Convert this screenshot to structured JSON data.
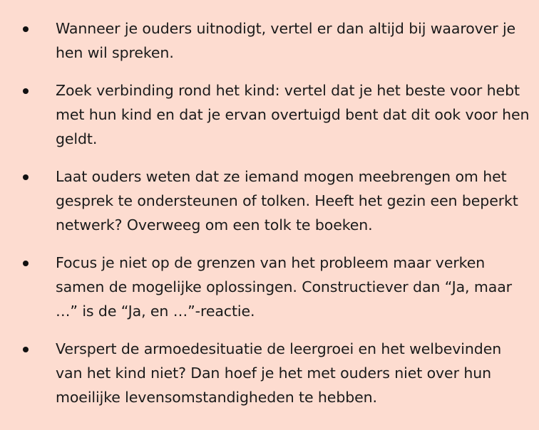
{
  "tips": [
    {
      "text": "Wanneer je ouders uitnodigt, vertel er dan altijd bij waarover je hen wil spreken."
    },
    {
      "text": "Zoek verbinding rond het kind: vertel dat je het beste voor hebt met hun kind en dat je ervan overtuigd bent dat dit ook voor hen geldt."
    },
    {
      "text": "Laat ouders weten dat ze iemand mogen meebrengen om het gesprek te ondersteunen of tolken. Heeft het gezin een beperkt netwerk? Overweeg om een tolk te boeken."
    },
    {
      "text": "Focus je niet op de grenzen van het probleem maar verken samen de mogelijke oplossingen. Constructiever dan “Ja, maar …” is de “Ja, en …”-reactie."
    },
    {
      "text": "Verspert de armoedesituatie de leergroei en het welbevinden van het kind niet? Dan hoef je het met ouders niet over hun moeilijke levensomstandigheden te hebben."
    }
  ]
}
